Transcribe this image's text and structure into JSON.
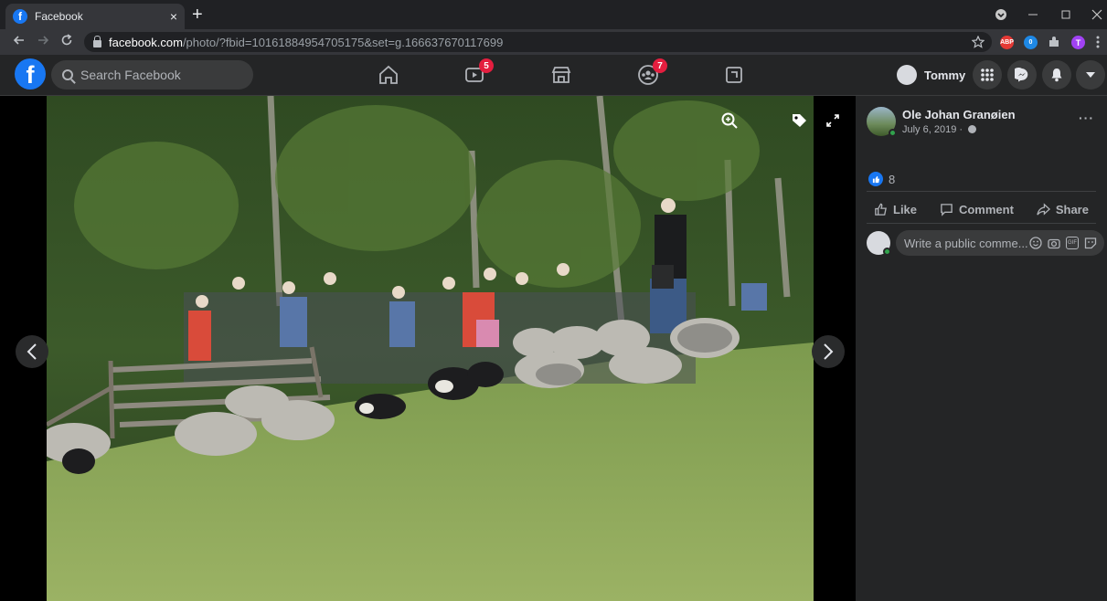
{
  "browser": {
    "tab_title": "Facebook",
    "tab_close": "×",
    "new_tab": "+",
    "url_host": "facebook.com",
    "url_path": "/photo/?fbid=10161884954705175&set=g.166637670117699",
    "ext_abp": "ABP",
    "ext_count": "0",
    "profile_initial": "T"
  },
  "fb": {
    "search_placeholder": "Search Facebook",
    "watch_badge": "5",
    "groups_badge": "7",
    "user_name": "Tommy"
  },
  "post": {
    "author": "Ole Johan Granøien",
    "date": "July 6, 2019 · ",
    "like_count": "8",
    "like_label": "Like",
    "comment_label": "Comment",
    "share_label": "Share",
    "comment_placeholder": "Write a public comme..."
  },
  "colors": {
    "fb_blue": "#1877f2",
    "badge_red": "#e41e3f",
    "online_green": "#31a24c"
  }
}
